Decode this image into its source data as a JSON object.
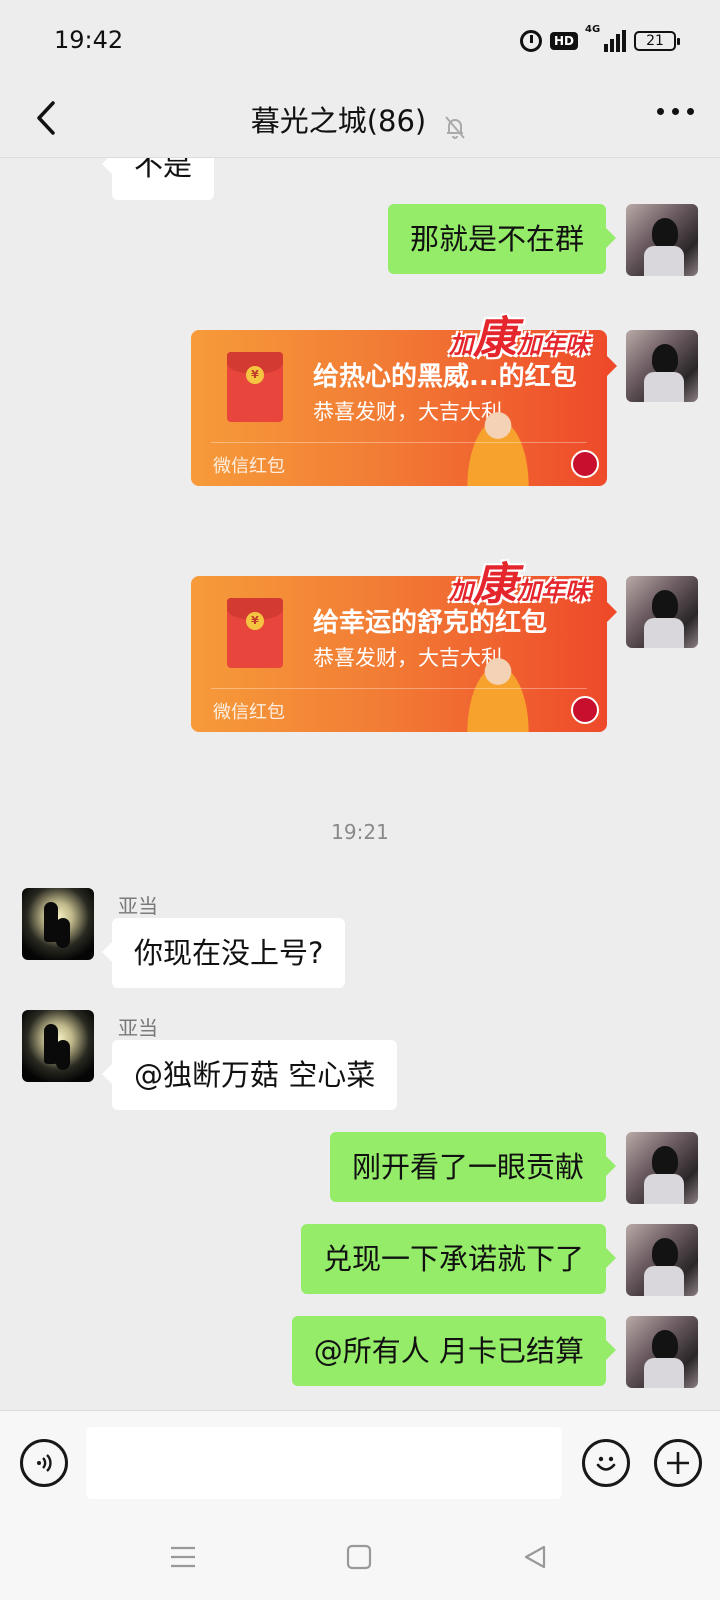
{
  "status": {
    "time": "19:42",
    "hd": "HD",
    "network": "4G",
    "battery": "21"
  },
  "header": {
    "title": "暮光之城(86)"
  },
  "messages": {
    "partial_text": "不是",
    "m1": "那就是不在群",
    "rp1": {
      "title": "给热心的黑威...的红包",
      "subtitle": "恭喜发财，大吉大利",
      "footer": "微信红包",
      "promo_big": "康",
      "promo_prefix": "加",
      "promo_suffix": "加年味"
    },
    "rp2": {
      "title": "给幸运的舒克的红包",
      "subtitle": "恭喜发财，大吉大利",
      "footer": "微信红包",
      "promo_big": "康",
      "promo_prefix": "加",
      "promo_suffix": "加年味"
    },
    "timestamp": "19:21",
    "m2": {
      "sender": "亚当",
      "text": "你现在没上号?"
    },
    "m3": {
      "sender": "亚当",
      "text": "@独断万菇  空心菜"
    },
    "m4": "刚开看了一眼贡献",
    "m5": "兑现一下承诺就下了",
    "m6": "@所有人  月卡已结算"
  },
  "colors": {
    "my_bubble": "#95ec69",
    "other_bubble": "#ffffff",
    "background": "#ededed"
  }
}
